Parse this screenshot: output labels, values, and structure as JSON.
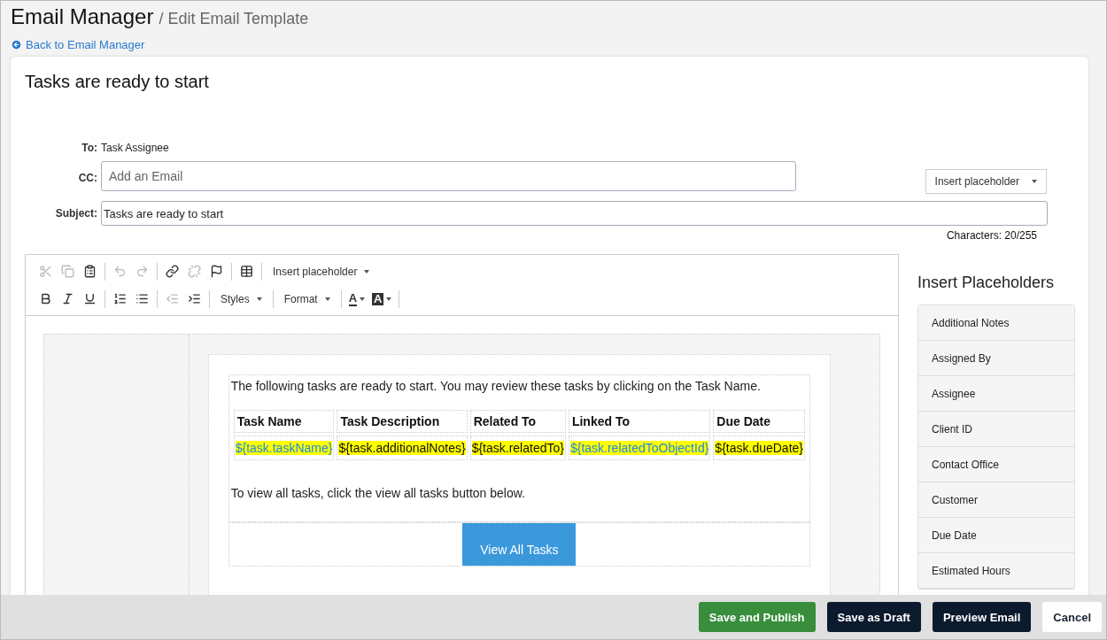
{
  "header": {
    "title": "Email Manager",
    "subtitle": "/ Edit Email Template"
  },
  "back_link": "Back to Email Manager",
  "template_title": "Tasks are ready to start",
  "form": {
    "to_label": "To:",
    "to_value": "Task Assignee",
    "cc_label": "CC:",
    "cc_placeholder": "Add an Email",
    "insert_placeholder": "Insert placeholder",
    "subject_label": "Subject:",
    "subject_value": "Tasks are ready to start",
    "characters": "Characters: 20/255"
  },
  "toolbar": [
    [
      {
        "kind": "icon",
        "disabled": true
      },
      {
        "kind": "icon",
        "disabled": true
      },
      {
        "kind": "icon",
        "disabled": false
      },
      {
        "kind": "separator"
      },
      {
        "kind": "icon",
        "disabled": true
      },
      {
        "kind": "icon",
        "disabled": true
      },
      {
        "kind": "separator"
      },
      {
        "kind": "icon",
        "disabled": false
      },
      {
        "kind": "icon",
        "disabled": true
      },
      {
        "kind": "icon",
        "disabled": false
      },
      {
        "kind": "separator"
      },
      {
        "kind": "icon",
        "disabled": false
      },
      {
        "kind": "separator"
      },
      {
        "kind": "dropdown",
        "label": "Insert placeholder"
      }
    ],
    [
      {
        "kind": "icon",
        "disabled": false
      },
      {
        "kind": "icon",
        "disabled": false
      },
      {
        "kind": "icon",
        "disabled": false
      },
      {
        "kind": "separator"
      },
      {
        "kind": "icon",
        "disabled": false
      },
      {
        "kind": "icon",
        "disabled": false
      },
      {
        "kind": "separator"
      },
      {
        "kind": "icon",
        "disabled": true
      },
      {
        "kind": "icon",
        "disabled": false
      },
      {
        "kind": "separator"
      },
      {
        "kind": "dropdown",
        "label": "Styles"
      },
      {
        "kind": "separator"
      },
      {
        "kind": "dropdown",
        "label": "Format"
      },
      {
        "kind": "separator"
      },
      {
        "kind": "textcolor",
        "label": "A"
      },
      {
        "kind": "bgcolor",
        "label": "A"
      },
      {
        "kind": "separator"
      }
    ]
  ],
  "email": {
    "intro": "The following tasks are ready to start. You may review these tasks by clicking on the Task Name.",
    "columns": [
      "Task Name",
      "Task Description",
      "Related To",
      "Linked To",
      "Due Date"
    ],
    "placeholders": [
      {
        "text": "${task.taskName}",
        "linked": true
      },
      {
        "text": "${task.additionalNotes}",
        "linked": false
      },
      {
        "text": "${task.relatedTo}",
        "linked": false
      },
      {
        "text": "${task.relatedToObjectId}",
        "linked": true
      },
      {
        "text": "${task.dueDate}",
        "linked": false
      }
    ],
    "outro": "To view all tasks, click the view all tasks button below.",
    "button": "View All Tasks"
  },
  "sidebar": {
    "title": "Insert Placeholders",
    "items": [
      "Additional Notes",
      "Assigned By",
      "Assignee",
      "Client ID",
      "Contact Office",
      "Customer",
      "Due Date",
      "Estimated Hours"
    ]
  },
  "footer": [
    {
      "label": "Save and Publish",
      "kind": "primary"
    },
    {
      "label": "Save as Draft",
      "kind": "dark"
    },
    {
      "label": "Preview Email",
      "kind": "dark"
    },
    {
      "label": "Cancel",
      "kind": "plain"
    }
  ]
}
